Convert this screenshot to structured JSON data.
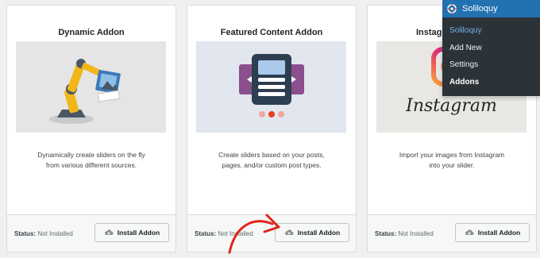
{
  "cards": [
    {
      "title": "Dynamic Addon",
      "description_line1": "Dynamically create sliders on the fly",
      "description_line2": "from various different sources.",
      "status_label": "Status:",
      "status_value": "Not Installed",
      "button_label": "Install Addon",
      "image_icon": "robotic-arm-icon"
    },
    {
      "title": "Featured Content Addon",
      "description_line1": "Create sliders based on your posts,",
      "description_line2": "pages, and/or custom post types.",
      "status_label": "Status:",
      "status_value": "Not Installed",
      "button_label": "Install Addon",
      "image_icon": "featured-slider-icon"
    },
    {
      "title": "Instagram Addon",
      "description_line1": "Import your images from Instagram",
      "description_line2": "into your slider.",
      "status_label": "Status:",
      "status_value": "Not Installed",
      "button_label": "Install Addon",
      "image_icon": "instagram-logo",
      "image_text": "Instagram"
    }
  ],
  "flyout": {
    "title": "Soliloquy",
    "items": [
      "Soliloquy",
      "Add New",
      "Settings",
      "Addons"
    ]
  },
  "colors": {
    "wp_blue": "#2271b1",
    "menu_bg": "#2c3338",
    "current_item": "#72aee6",
    "annotation_arrow": "#e0241b"
  }
}
